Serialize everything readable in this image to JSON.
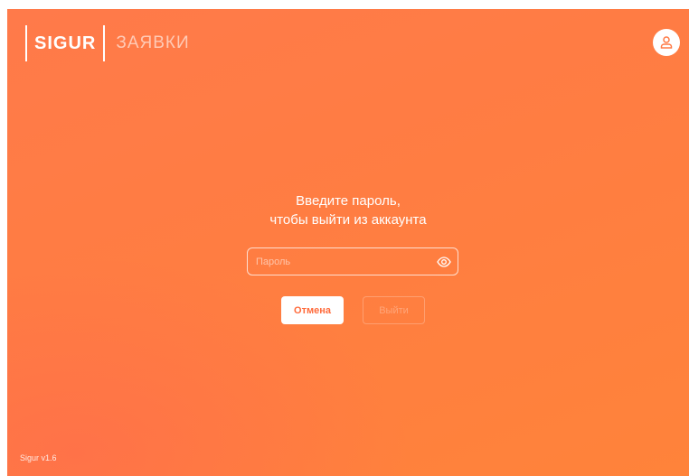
{
  "header": {
    "brand": "SIGUR",
    "section": "ЗАЯВКИ",
    "user_icon": "user-icon"
  },
  "logout": {
    "prompt_line1": "Введите пароль,",
    "prompt_line2": "чтобы выйти из аккаунта",
    "password": {
      "placeholder": "Пароль",
      "value": "",
      "toggle_icon": "eye-icon"
    },
    "cancel_label": "Отмена",
    "exit_label": "Выйти"
  },
  "footer": {
    "version": "Sigur v1.6"
  },
  "colors": {
    "accent": "#ff7a45",
    "cancel_text": "#ff6a3a",
    "white": "#ffffff"
  }
}
